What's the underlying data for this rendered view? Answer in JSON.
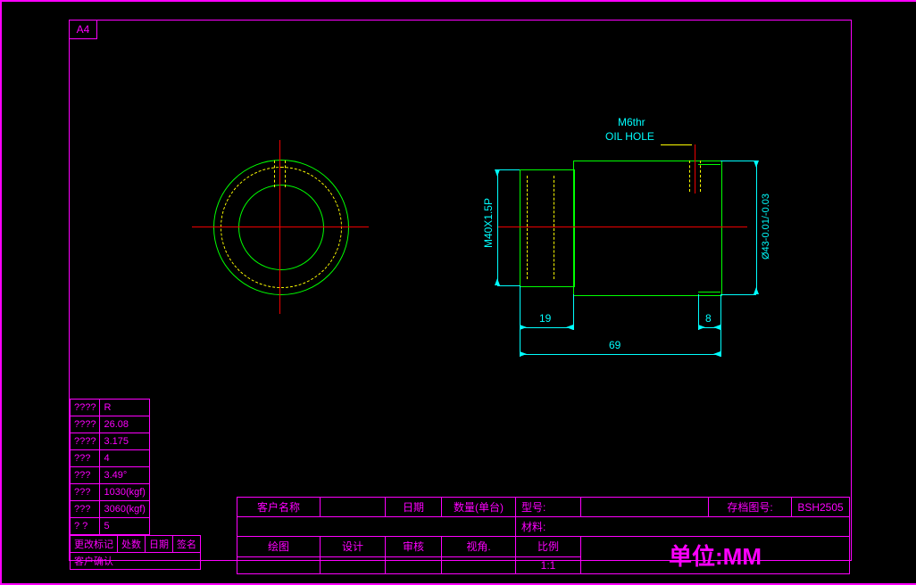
{
  "sheet": {
    "size": "A4"
  },
  "annotations": {
    "thread_note_1": "M6thr",
    "thread_note_2": "OIL HOLE",
    "dim_thread": "M40X1.5P",
    "dim_dia": "Ø43-0.01/-0.03",
    "dim_19": "19",
    "dim_8": "8",
    "dim_69": "69"
  },
  "spec_table": {
    "rows": [
      [
        "????",
        "R"
      ],
      [
        "????",
        "26.08"
      ],
      [
        "????",
        "3.175"
      ],
      [
        "???",
        "4"
      ],
      [
        "???",
        "3.49°"
      ],
      [
        "???",
        "1030(kgf)"
      ],
      [
        "???",
        "3060(kgf)"
      ],
      [
        "?  ?",
        "5"
      ]
    ]
  },
  "rev_table": {
    "headers": [
      "更改标记",
      "处数",
      "日期",
      "签名"
    ],
    "row2": "客户确认"
  },
  "title_block": {
    "customer_label": "客户名称",
    "date_label": "日期",
    "qty_label": "数量(单台)",
    "model_label": "型号:",
    "archive_label": "存档图号:",
    "archive_no": "BSH2505",
    "material_label": "材料:",
    "drawn_label": "绘图",
    "design_label": "设计",
    "check_label": "审核",
    "view_label": "视角.",
    "scale_label": "比例",
    "scale": "1:1",
    "unit": "单位:MM"
  }
}
